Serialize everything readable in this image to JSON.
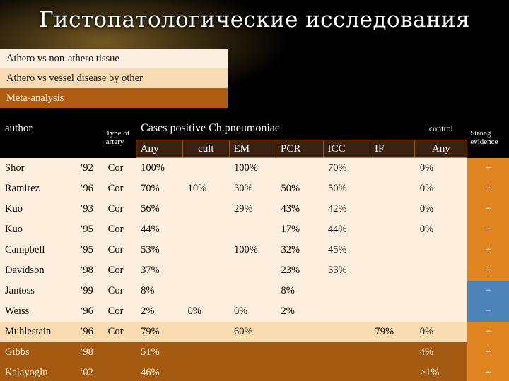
{
  "slide": {
    "title": "Гистопатологические исследования",
    "accent_gold": "#c9a030",
    "accent_orange": "#e08420",
    "accent_blue": "#4d83b8",
    "accent_brown": "#a3590f"
  },
  "bullets": [
    {
      "label": "Athero vs non-athero tissue"
    },
    {
      "label": "Athero vs vessel disease by other"
    },
    {
      "label": "Meta-analysis"
    }
  ],
  "table": {
    "header": {
      "author": "author",
      "type_of_artery": "Type of artery",
      "cases_group": "Cases positive Ch.pneumoniae",
      "control_group": "control",
      "strong_evidence": "Strong evidence"
    },
    "subheader": {
      "any": "Any",
      "cult": "cult",
      "em": "EM",
      "pcr": "PCR",
      "icc": "ICC",
      "if": "IF",
      "control_any": "Any"
    },
    "rows": [
      {
        "author": "Shor",
        "year": "’92",
        "artery": "Cor",
        "any": "100%",
        "cult": "",
        "em": "100%",
        "pcr": "",
        "icc": "70%",
        "if": "",
        "control": "0%",
        "evidence": "+",
        "style": "light"
      },
      {
        "author": "Ramirez",
        "year": "’96",
        "artery": "Cor",
        "any": "70%",
        "cult": "10%",
        "em": "30%",
        "pcr": "50%",
        "icc": "50%",
        "if": "",
        "control": "0%",
        "evidence": "+",
        "style": "light"
      },
      {
        "author": "Kuo",
        "year": "’93",
        "artery": "Cor",
        "any": "56%",
        "cult": "",
        "em": "29%",
        "pcr": "43%",
        "icc": "42%",
        "if": "",
        "control": "0%",
        "evidence": "+",
        "style": "light"
      },
      {
        "author": "Kuo",
        "year": "’95",
        "artery": "Cor",
        "any": "44%",
        "cult": "",
        "em": "",
        "pcr": "17%",
        "icc": "44%",
        "if": "",
        "control": "0%",
        "evidence": "+",
        "style": "light"
      },
      {
        "author": "Campbell",
        "year": "’95",
        "artery": "Cor",
        "any": "53%",
        "cult": "",
        "em": "100%",
        "pcr": "32%",
        "icc": "45%",
        "if": "",
        "control": "",
        "evidence": "+",
        "style": "light"
      },
      {
        "author": "Davidson",
        "year": "’98",
        "artery": "Cor",
        "any": "37%",
        "cult": "",
        "em": "",
        "pcr": "23%",
        "icc": "33%",
        "if": "",
        "control": "",
        "evidence": "+",
        "style": "light"
      },
      {
        "author": "Jantoss",
        "year": "’99",
        "artery": "Cor",
        "any": "8%",
        "cult": "",
        "em": "",
        "pcr": "8%",
        "icc": "",
        "if": "",
        "control": "",
        "evidence": "−",
        "style": "light"
      },
      {
        "author": "Weiss",
        "year": "’96",
        "artery": "Cor",
        "any": "2%",
        "cult": "0%",
        "em": "0%",
        "pcr": "2%",
        "icc": "",
        "if": "",
        "control": "",
        "evidence": "−",
        "style": "light"
      },
      {
        "author": "Muhlestain",
        "year": "’96",
        "artery": "Cor",
        "any": "79%",
        "cult": "",
        "em": "60%",
        "pcr": "",
        "icc": "",
        "if": "79%",
        "control": "0%",
        "evidence": "+",
        "style": "mid"
      },
      {
        "author": "Gibbs",
        "year": "’98",
        "artery": "",
        "any": "51%",
        "cult": "",
        "em": "",
        "pcr": "",
        "icc": "",
        "if": "",
        "control": "4%",
        "evidence": "+",
        "style": "brown"
      },
      {
        "author": "Kalayoglu",
        "year": "‘02",
        "artery": "",
        "any": "46%",
        "cult": "",
        "em": "",
        "pcr": "",
        "icc": "",
        "if": "",
        "control": ">1%",
        "evidence": "+",
        "style": "brown"
      }
    ]
  }
}
